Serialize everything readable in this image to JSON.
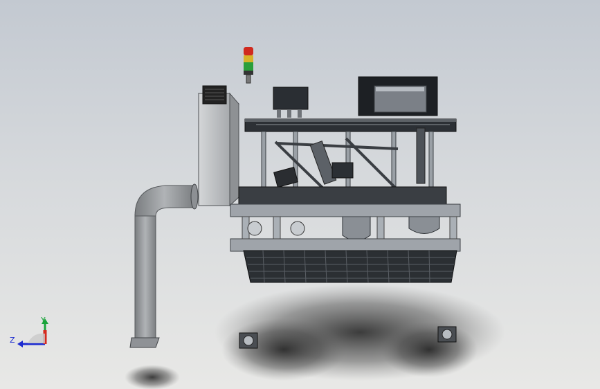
{
  "triad": {
    "z_label": "Z",
    "y_label": "Y"
  },
  "colors": {
    "background_top": "#c3c9d1",
    "background_bottom": "#e8e8e6",
    "frame_steel": "#8d9298",
    "dark_steel": "#2f3338",
    "cabinet": "#b9bcbf",
    "duct": "#9a9da0",
    "signal_red": "#d02a1e",
    "signal_yellow": "#d7b32a",
    "signal_green": "#2b9f3a",
    "axis_x": "#d52a1f",
    "axis_y": "#19a43a",
    "axis_z": "#1c2bd0"
  }
}
